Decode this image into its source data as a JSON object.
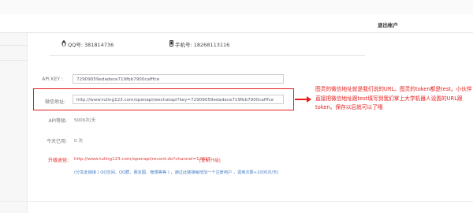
{
  "header": {
    "logout_label": "退出帐户"
  },
  "account": {
    "qq_label": "QQ号: 381814736",
    "phone_label": "手机号: 18268113116"
  },
  "form": {
    "api_key_label": "API KEY :",
    "api_key_value": "72909059edadece719fbb7900cafffce",
    "wechat_label": "微信地址:",
    "wechat_value": "http://www.tuling123.com/openapi/wechatapi?key=72909059edadece719fbb7900cafffce",
    "api_level_label": "API等级:",
    "api_level_value": "5000次/天",
    "today_used_label": "今天已用:",
    "today_used_value": "0 次",
    "upgrade_label": "升级途径:",
    "upgrade_link": "http://www.tuling123.com/openapi/record.do?channel=12827",
    "upgrade_copy": "[复制升级]",
    "share_text": "(分享此链接 ( QQ空间、QQ群、朋友圈、微博等等 ) ，通过此链接每增加一个注册用户 ，调用次数+1000次/天)"
  },
  "annotation": {
    "text": "图灵的微信地址就是我们说的URL。图灵的token都是test。小伙伴直接把微信地址跟test填写到我们掌上大学机器人设置的URL跟token。保存以后就可以了哦"
  },
  "colors": {
    "highlight": "#e81c1c",
    "link": "#4a7fc4"
  },
  "icons": {
    "qq": "penguin-icon",
    "phone": "phone-icon"
  }
}
